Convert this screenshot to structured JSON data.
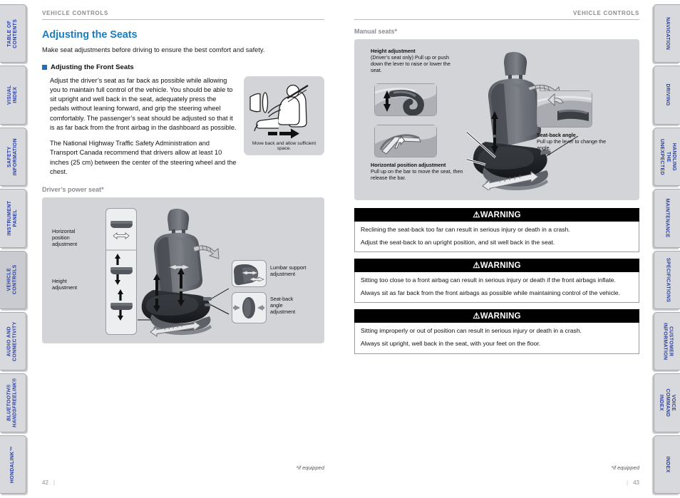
{
  "left_tabs": [
    {
      "label": "TABLE OF CONTENTS",
      "active": false,
      "italic": false
    },
    {
      "label": "VISUAL INDEX",
      "active": false,
      "italic": false
    },
    {
      "label": "SAFETY\nINFORMATION",
      "active": false,
      "italic": false
    },
    {
      "label": "INSTRUMENT PANEL",
      "active": false,
      "italic": false
    },
    {
      "label": "VEHICLE\nCONTROLS",
      "active": true,
      "italic": false
    },
    {
      "label": "AUDIO AND\nCONNECTIVITY",
      "active": false,
      "italic": false
    },
    {
      "label": "BLUETOOTH®\nHANDSFREELINK®",
      "active": false,
      "italic": true
    },
    {
      "label": "HONDALINK™",
      "active": false,
      "italic": false
    }
  ],
  "right_tabs": [
    {
      "label": "NAVIGATION",
      "active": false,
      "italic": false
    },
    {
      "label": "DRIVING",
      "active": false,
      "italic": false
    },
    {
      "label": "HANDLING THE\nUNEXPECTED",
      "active": false,
      "italic": false
    },
    {
      "label": "MAINTENANCE",
      "active": false,
      "italic": false
    },
    {
      "label": "SPECIFICATIONS",
      "active": false,
      "italic": false
    },
    {
      "label": "CUSTOMER\nINFORMATION",
      "active": false,
      "italic": false
    },
    {
      "label": "VOICE COMMAND\nINDEX",
      "active": false,
      "italic": false
    },
    {
      "label": "INDEX",
      "active": false,
      "italic": false
    }
  ],
  "left_page": {
    "running_head": "VEHICLE CONTROLS",
    "title": "Adjusting the Seats",
    "lede": "Make seat adjustments before driving to ensure the best comfort and safety.",
    "section_heading": "Adjusting the Front Seats",
    "paragraph_1": "Adjust the driver’s seat as far back as possible while allowing you to maintain full control of the vehicle. You should be able to sit upright and well back in the seat, adequately press the pedals without leaning forward, and grip the steering wheel comfortably. The passenger’s seat should be adjusted so that it is as far back from the front airbag in the dashboard as possible.",
    "paragraph_2": "The National Highway Traffic Safety Administration and Transport Canada recommend that drivers allow at least 10 inches (25 cm) between the center of the steering wheel and the chest.",
    "inline_figure_caption": "Move back and allow sufficient space.",
    "panel_label": "Driver’s power seat*",
    "power_seat_labels": {
      "horizontal": "Horizontal\nposition\nadjustment",
      "height": "Height\nadjustment",
      "lumbar": "Lumbar support\nadjustment",
      "seatback": "Seat-back\nangle\nadjustment"
    },
    "footnote": "*if equipped",
    "page_number": "42"
  },
  "right_page": {
    "running_head": "VEHICLE CONTROLS",
    "panel_label": "Manual seats*",
    "manual_seat_labels": {
      "height_title": "Height adjustment",
      "height_text": "(Driver’s seat only) Pull up or push down the lever to raise or lower the seat.",
      "horizontal_title": "Horizontal position adjustment",
      "horizontal_text": "Pull up on the bar to move the seat, then release the bar.",
      "seatback_title": "Seat-back angle",
      "seatback_text": "Pull up the lever to change the angle."
    },
    "warnings": [
      {
        "heading": "⚠WARNING",
        "lines": [
          "Reclining the seat-back too far can result in serious injury or death in a crash.",
          "Adjust the seat-back to an upright position, and sit well back in the seat."
        ]
      },
      {
        "heading": "⚠WARNING",
        "lines": [
          "Sitting too close to a front airbag can result in serious injury or death if the front airbags inflate.",
          "Always sit as far back from the front airbags as possible while maintaining control of the vehicle."
        ]
      },
      {
        "heading": "⚠WARNING",
        "lines": [
          "Sitting improperly or out of position can result in serious injury or death in a crash.",
          "Always sit upright, well back in the seat, with your feet on the floor."
        ]
      }
    ],
    "footnote": "*if equipped",
    "page_number": "43"
  },
  "colors": {
    "title_blue": "#1a7cc1",
    "tab_text_blue": "#2b3f9e",
    "panel_grey": "#d3d4d8",
    "runhead_grey": "#8a8c90"
  }
}
